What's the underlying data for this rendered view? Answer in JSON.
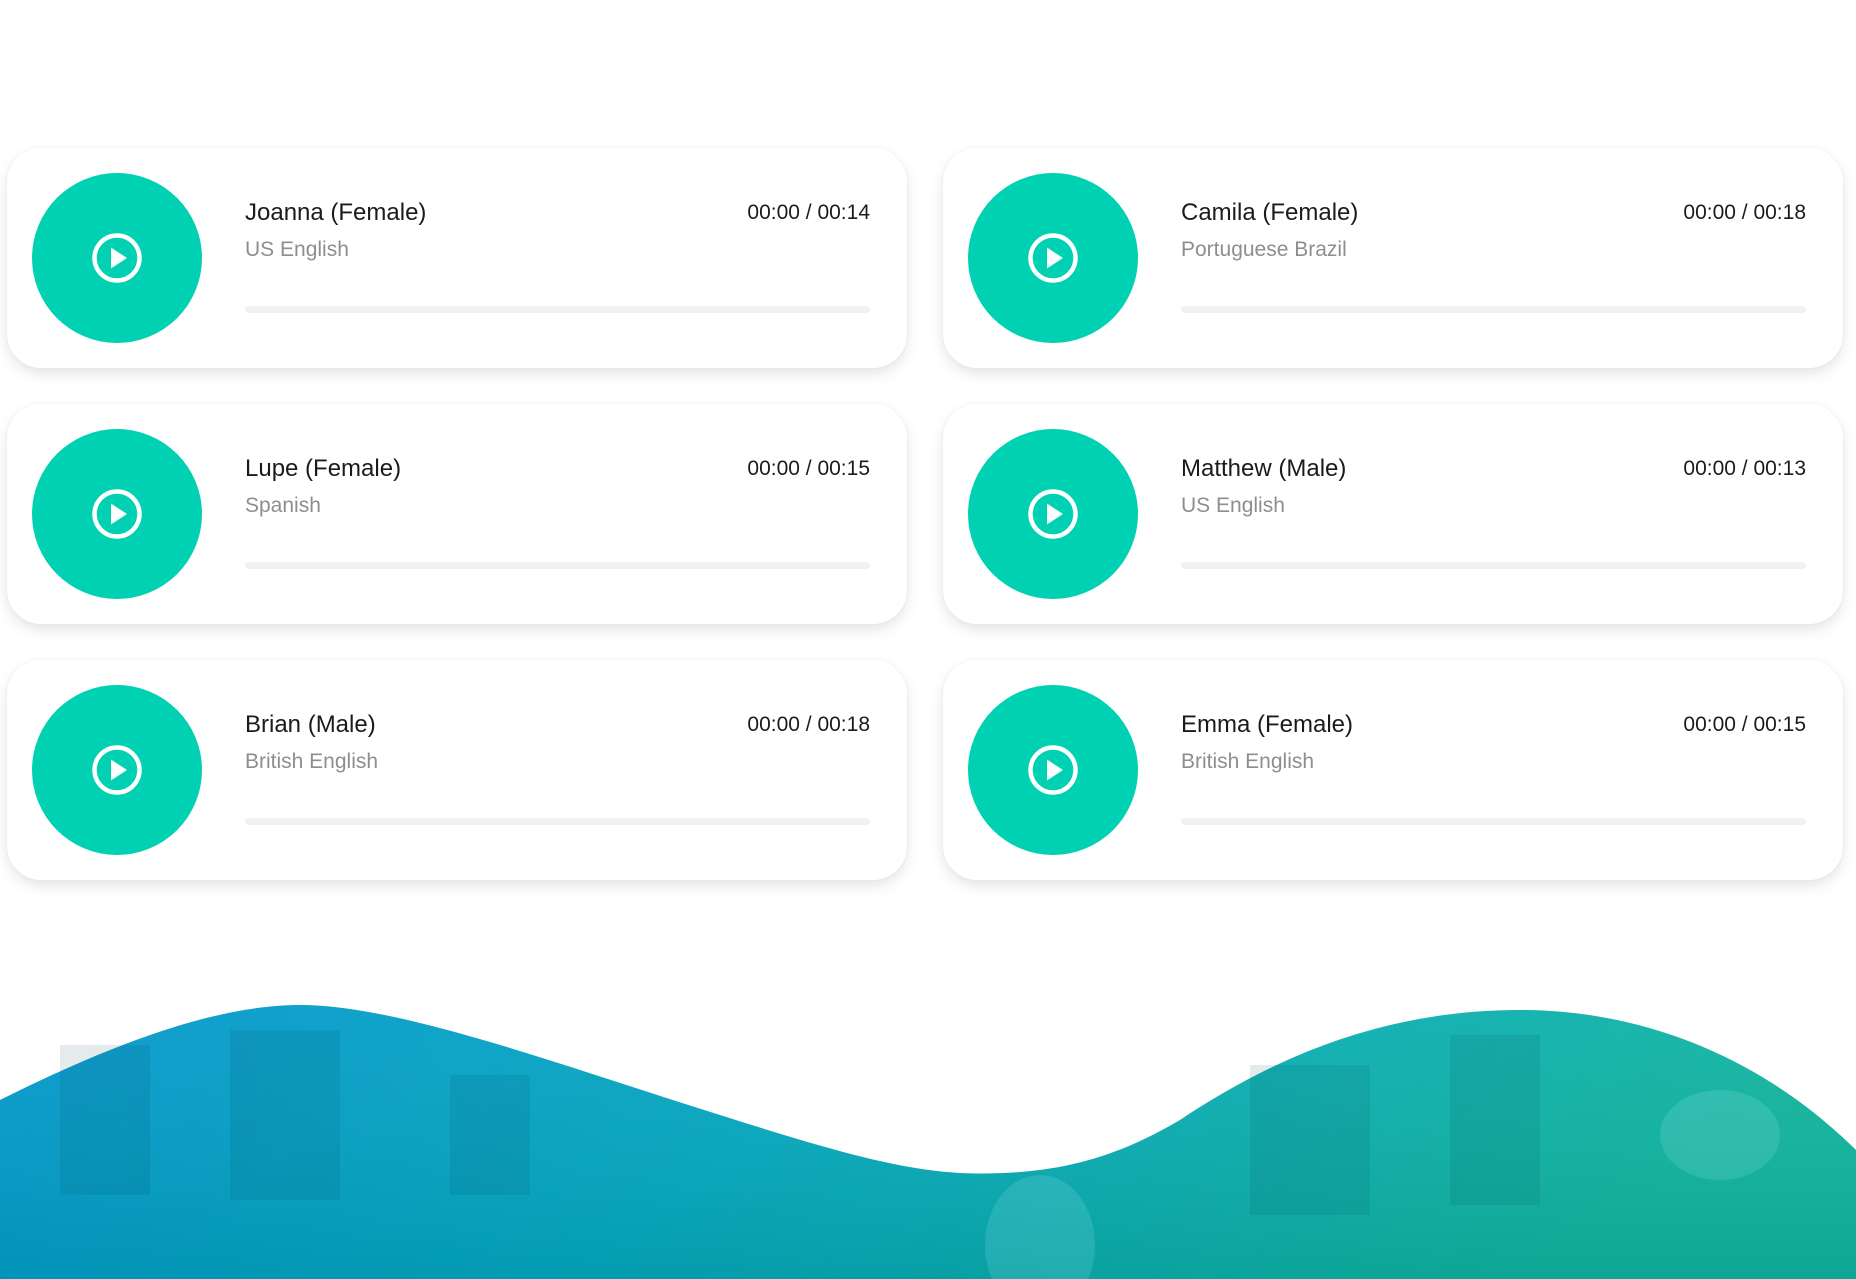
{
  "accent_color": "#00d1b2",
  "players": [
    {
      "name": "Joanna (Female)",
      "language": "US English",
      "time": "00:00 / 00:14",
      "progress": 0,
      "icon": "play-circle-icon"
    },
    {
      "name": "Camila (Female)",
      "language": "Portuguese Brazil",
      "time": "00:00 / 00:18",
      "progress": 0,
      "icon": "play-circle-icon"
    },
    {
      "name": "Lupe (Female)",
      "language": "Spanish",
      "time": "00:00 / 00:15",
      "progress": 0,
      "icon": "play-circle-icon"
    },
    {
      "name": "Matthew (Male)",
      "language": "US English",
      "time": "00:00 / 00:13",
      "progress": 0,
      "icon": "play-circle-icon"
    },
    {
      "name": "Brian (Male)",
      "language": "British English",
      "time": "00:00 / 00:18",
      "progress": 0,
      "icon": "play-circle-icon"
    },
    {
      "name": "Emma (Female)",
      "language": "British English",
      "time": "00:00 / 00:15",
      "progress": 0,
      "icon": "play-circle-icon"
    }
  ],
  "hero": {
    "gradient_start": "#0096cc",
    "gradient_end": "#0fb59c"
  }
}
